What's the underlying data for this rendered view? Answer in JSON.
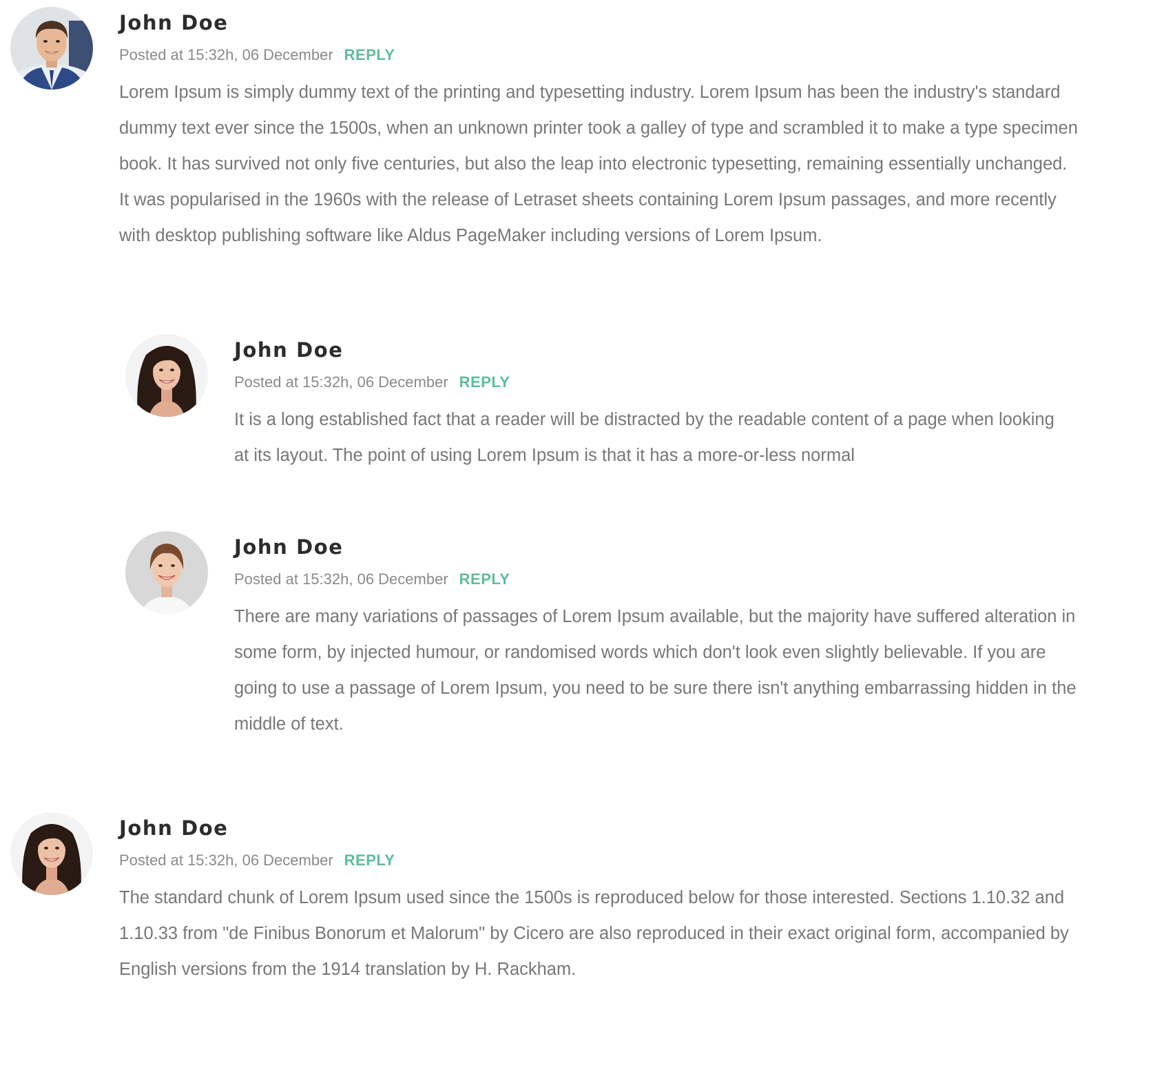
{
  "accent_color": "#5cbf98",
  "text_color": "#777777",
  "author_color": "#2c2c2c",
  "comments": [
    {
      "author": "John Doe",
      "posted": "Posted at 15:32h, 06 December",
      "reply_label": "REPLY",
      "avatar_icon": "avatar-man-photo",
      "body": "Lorem Ipsum is simply dummy text of the printing and typesetting industry. Lorem Ipsum has been the industry's standard dummy text ever since the 1500s, when an unknown printer took a galley of type and scrambled it to make a type specimen book. It has survived not only five centuries, but also the leap into electronic typesetting, remaining essentially unchanged. It was popularised in the 1960s with the release of Letraset sheets containing Lorem Ipsum passages, and more recently with desktop publishing software like Aldus PageMaker including versions of Lorem Ipsum."
    },
    {
      "author": "John Doe",
      "posted": "Posted at 15:32h, 06 December",
      "reply_label": "REPLY",
      "avatar_icon": "avatar-woman-dark-hair-photo",
      "body": "It is a long established fact that a reader will be distracted by the readable content of a page when looking at its layout. The point of using Lorem Ipsum is that it has a more-or-less normal"
    },
    {
      "author": "John Doe",
      "posted": "Posted at 15:32h, 06 December",
      "reply_label": "REPLY",
      "avatar_icon": "avatar-woman-light-hair-photo",
      "body": "There are many variations of passages of Lorem Ipsum available, but the majority have suffered alteration in some form, by injected humour, or randomised words which don't look even slightly believable. If you are going to use a passage of Lorem Ipsum, you need to be sure there isn't anything embarrassing hidden in the middle of text."
    },
    {
      "author": "John Doe",
      "posted": "Posted at 15:32h, 06 December",
      "reply_label": "REPLY",
      "avatar_icon": "avatar-woman-dark-hair-photo",
      "body": "The standard chunk of Lorem Ipsum used since the 1500s is reproduced below for those interested. Sections 1.10.32 and 1.10.33 from \"de Finibus Bonorum et Malorum\" by Cicero are also reproduced in their exact original form, accompanied by English versions from the 1914 translation by H. Rackham."
    }
  ]
}
